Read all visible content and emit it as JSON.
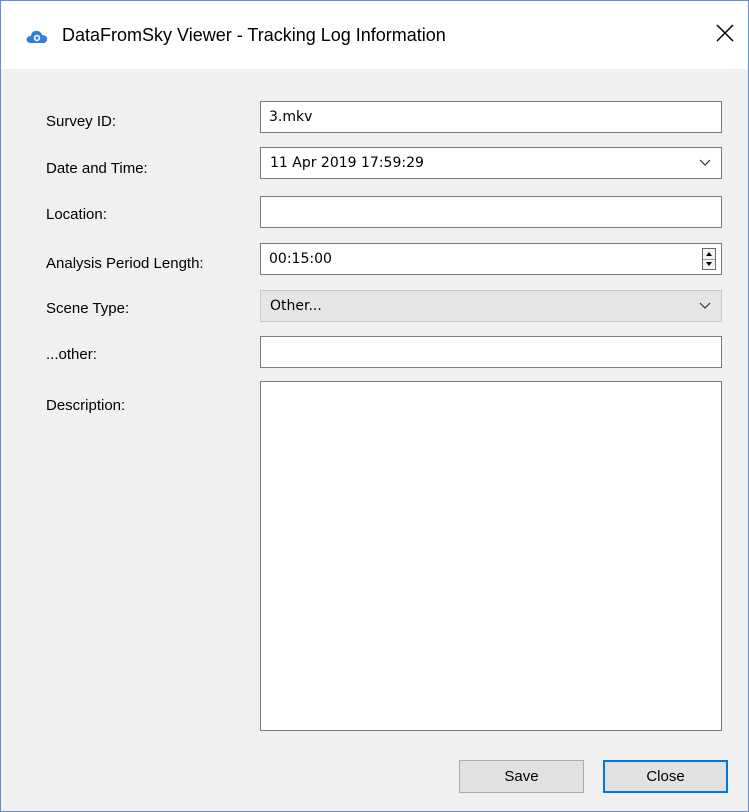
{
  "window": {
    "title": "DataFromSky Viewer - Tracking Log Information",
    "app_icon": "cloud-icon",
    "close_icon": "close-icon",
    "accent_color": "#0078d7"
  },
  "form": {
    "survey_id": {
      "label": "Survey ID:",
      "value": "3.mkv"
    },
    "date_time": {
      "label": "Date and Time:",
      "value": "11 Apr 2019 17:59:29"
    },
    "location": {
      "label": "Location:",
      "value": ""
    },
    "analysis_period": {
      "label": "Analysis Period Length:",
      "value": "00:15:00"
    },
    "scene_type": {
      "label": "Scene Type:",
      "value": "Other..."
    },
    "other": {
      "label": "...other:",
      "value": ""
    },
    "description": {
      "label": "Description:",
      "value": ""
    }
  },
  "buttons": {
    "save": "Save",
    "close": "Close"
  }
}
